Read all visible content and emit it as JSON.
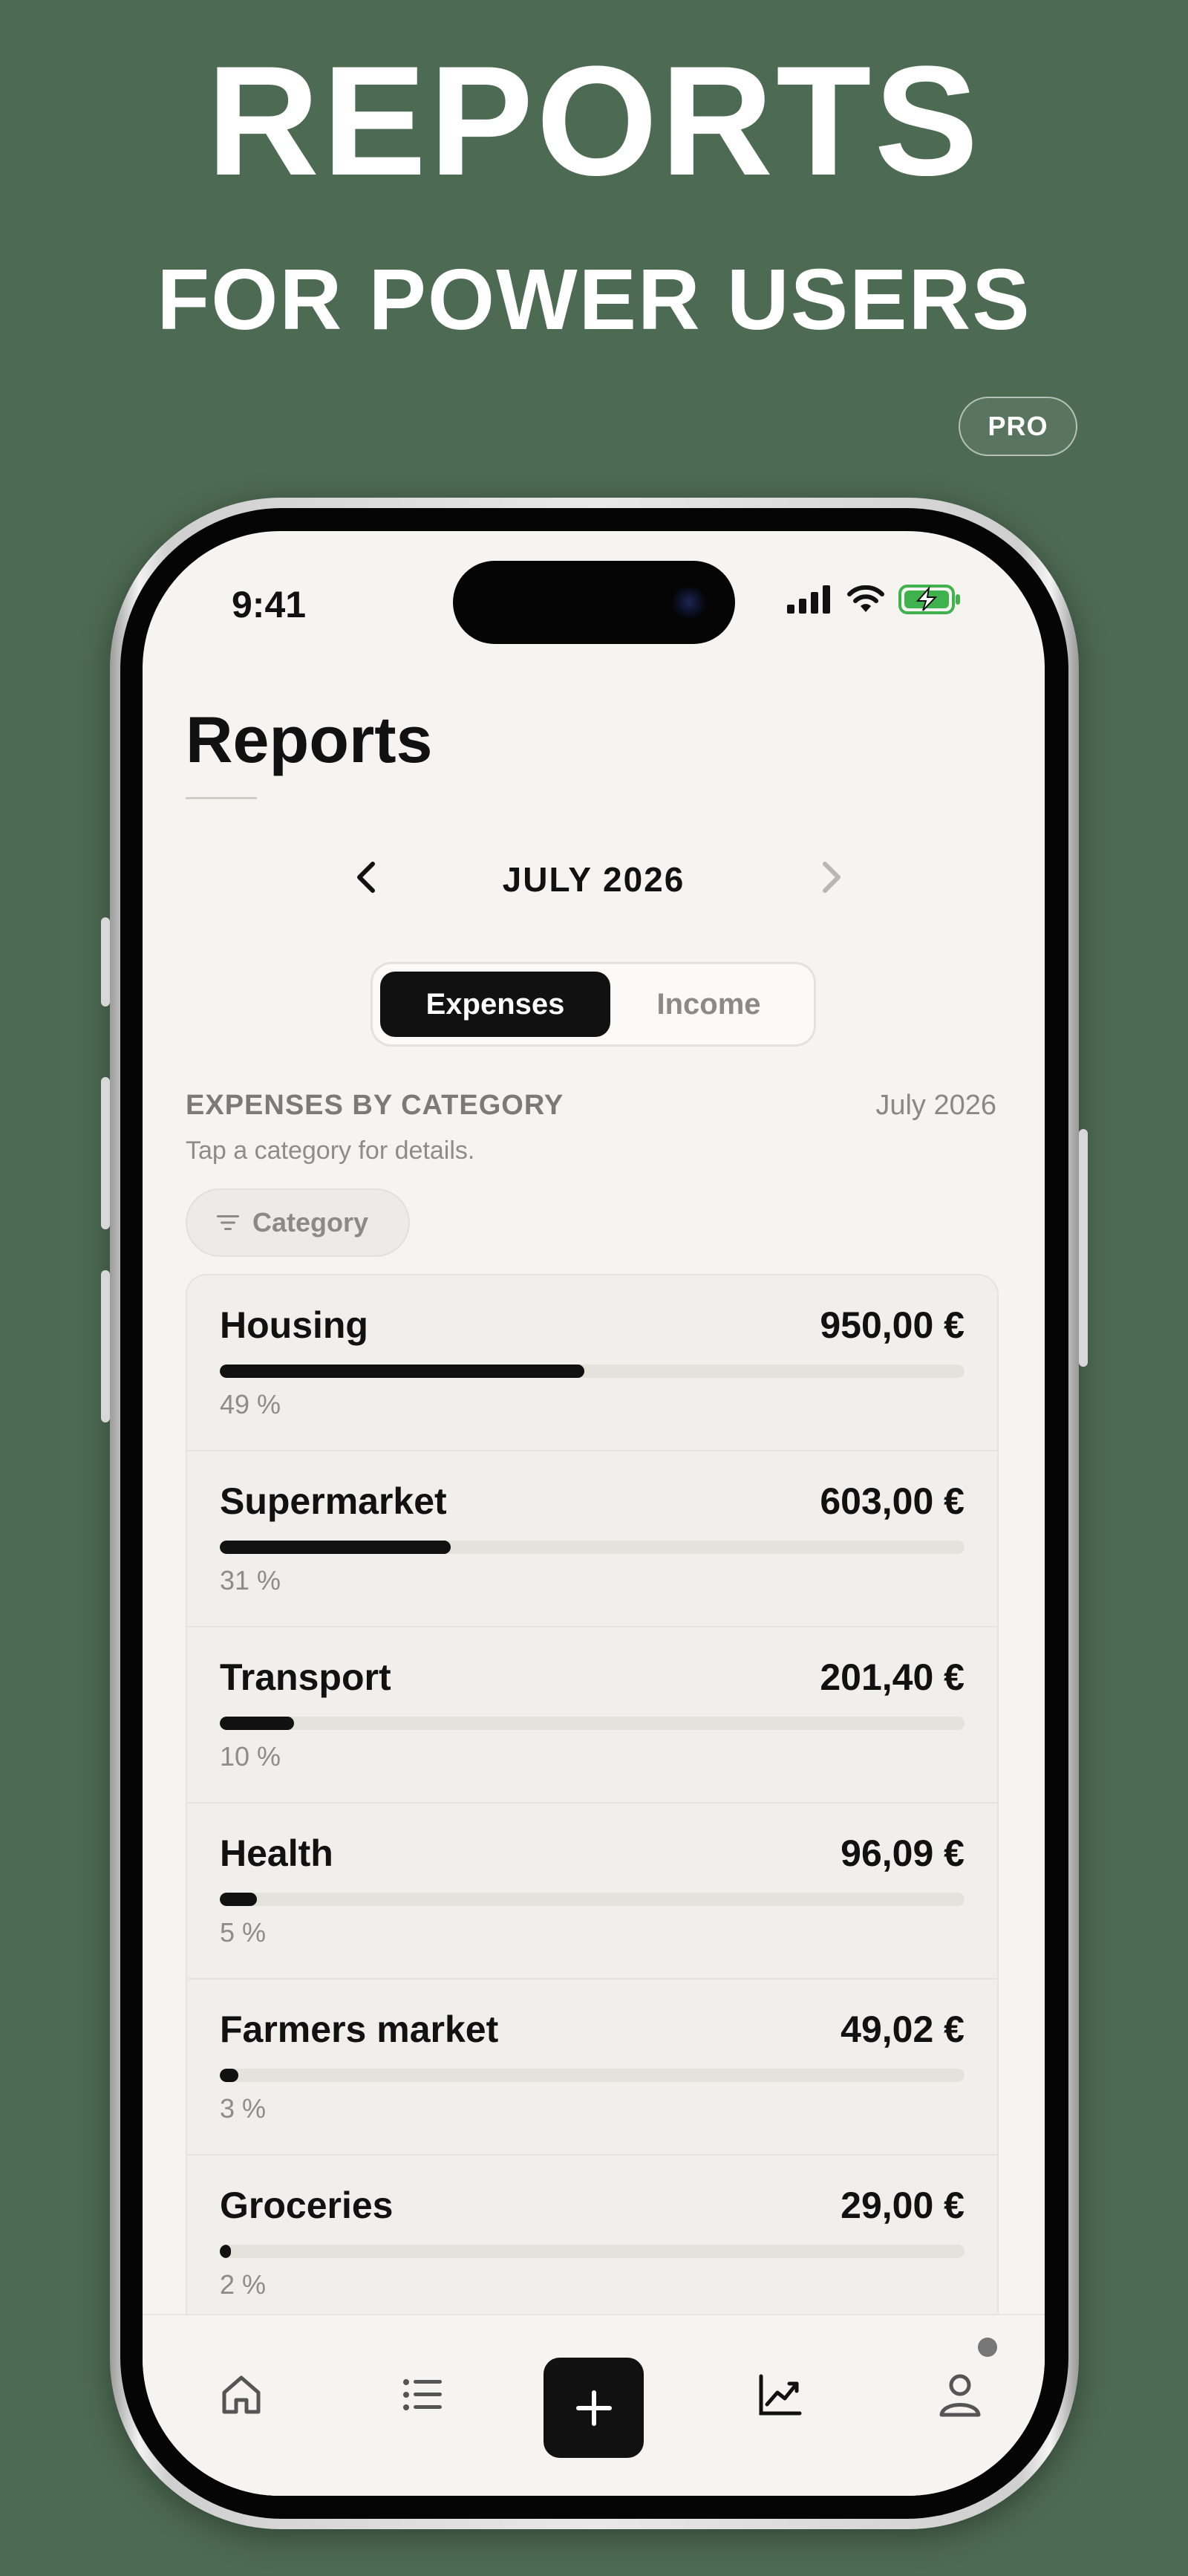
{
  "promo": {
    "title": "REPORTS",
    "subtitle": "FOR POWER USERS",
    "badge": "PRO"
  },
  "status_bar": {
    "time": "9:41",
    "icons": [
      "signal-icon",
      "wifi-icon",
      "battery-charging-icon"
    ]
  },
  "screen": {
    "title": "Reports",
    "month_nav": {
      "label": "JULY 2026",
      "prev_icon": "chevron-left-icon",
      "next_icon": "chevron-right-icon"
    },
    "segmented": {
      "options": [
        "Expenses",
        "Income"
      ],
      "selected": "Expenses"
    },
    "section": {
      "title": "EXPENSES BY CATEGORY",
      "date": "July 2026",
      "hint": "Tap a category for details."
    },
    "filter": {
      "label": "Category",
      "icon": "filter-lines-icon"
    },
    "categories": [
      {
        "name": "Housing",
        "amount": "950,00 €",
        "percent_label": "49 %",
        "share": 0.49
      },
      {
        "name": "Supermarket",
        "amount": "603,00 €",
        "percent_label": "31 %",
        "share": 0.31
      },
      {
        "name": "Transport",
        "amount": "201,40 €",
        "percent_label": "10 %",
        "share": 0.1
      },
      {
        "name": "Health",
        "amount": "96,09 €",
        "percent_label": "5 %",
        "share": 0.05
      },
      {
        "name": "Farmers market",
        "amount": "49,02 €",
        "percent_label": "3 %",
        "share": 0.025
      },
      {
        "name": "Groceries",
        "amount": "29,00 €",
        "percent_label": "2 %",
        "share": 0.015
      }
    ]
  },
  "tabbar": {
    "items": [
      "home-icon",
      "list-icon",
      "plus-icon",
      "chart-trend-icon",
      "person-icon"
    ]
  },
  "colors": {
    "background": "#4d6a52",
    "screen": "#f5f4f1",
    "accent": "#111111",
    "muted_text": "#8e8c88"
  }
}
